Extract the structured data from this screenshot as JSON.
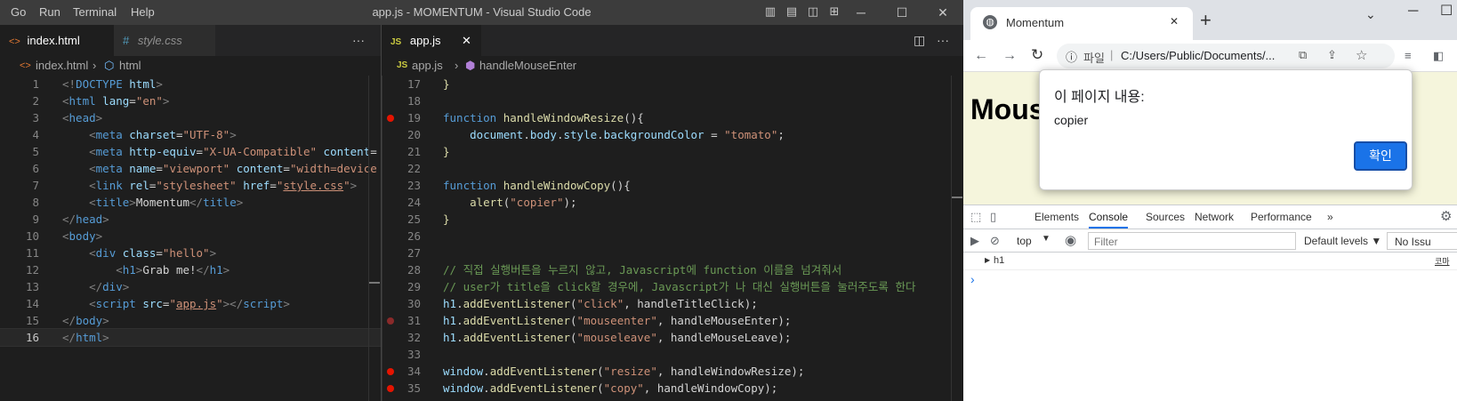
{
  "vscode": {
    "menu": [
      "Go",
      "Run",
      "Terminal",
      "Help"
    ],
    "window_title": "app.js - MOMENTUM - Visual Studio Code",
    "left_pane": {
      "tabs": [
        {
          "label": "index.html",
          "icon": "<>",
          "active": true
        },
        {
          "label": "style.css",
          "icon": "#",
          "active": false
        }
      ],
      "more_label": "···",
      "breadcrumb": {
        "file": "index.html",
        "symbol": "html"
      },
      "lines": [
        {
          "n": "1",
          "tokens": [
            [
              "<!",
              "p"
            ],
            [
              "DOCTYPE",
              "tag"
            ],
            [
              " html",
              "attr"
            ],
            [
              ">",
              "p"
            ]
          ]
        },
        {
          "n": "2",
          "tokens": [
            [
              "<",
              "p"
            ],
            [
              "html",
              "tag"
            ],
            [
              " lang",
              "attr"
            ],
            [
              "=",
              "text"
            ],
            [
              "\"en\"",
              "str"
            ],
            [
              ">",
              "p"
            ]
          ]
        },
        {
          "n": "3",
          "tokens": [
            [
              "<",
              "p"
            ],
            [
              "head",
              "tag"
            ],
            [
              ">",
              "p"
            ]
          ]
        },
        {
          "n": "4",
          "tokens": [
            [
              "    <",
              "p"
            ],
            [
              "meta",
              "tag"
            ],
            [
              " charset",
              "attr"
            ],
            [
              "=",
              "text"
            ],
            [
              "\"UTF-8\"",
              "str"
            ],
            [
              ">",
              "p"
            ]
          ]
        },
        {
          "n": "5",
          "tokens": [
            [
              "    <",
              "p"
            ],
            [
              "meta",
              "tag"
            ],
            [
              " http-equiv",
              "attr"
            ],
            [
              "=",
              "text"
            ],
            [
              "\"X-UA-Compatible\"",
              "str"
            ],
            [
              " content",
              "attr"
            ],
            [
              "=",
              "text"
            ]
          ]
        },
        {
          "n": "6",
          "tokens": [
            [
              "    <",
              "p"
            ],
            [
              "meta",
              "tag"
            ],
            [
              " name",
              "attr"
            ],
            [
              "=",
              "text"
            ],
            [
              "\"viewport\"",
              "str"
            ],
            [
              " content",
              "attr"
            ],
            [
              "=",
              "text"
            ],
            [
              "\"width=device",
              "str"
            ]
          ]
        },
        {
          "n": "7",
          "tokens": [
            [
              "    <",
              "p"
            ],
            [
              "link",
              "tag"
            ],
            [
              " rel",
              "attr"
            ],
            [
              "=",
              "text"
            ],
            [
              "\"stylesheet\"",
              "str"
            ],
            [
              " href",
              "attr"
            ],
            [
              "=",
              "text"
            ],
            [
              "\"",
              "str"
            ],
            [
              "style.css",
              "link"
            ],
            [
              "\"",
              "str"
            ],
            [
              ">",
              "p"
            ]
          ]
        },
        {
          "n": "8",
          "tokens": [
            [
              "    <",
              "p"
            ],
            [
              "title",
              "tag"
            ],
            [
              ">",
              "p"
            ],
            [
              "Momentum",
              "text"
            ],
            [
              "</",
              "p"
            ],
            [
              "title",
              "tag"
            ],
            [
              ">",
              "p"
            ]
          ]
        },
        {
          "n": "9",
          "tokens": [
            [
              "</",
              "p"
            ],
            [
              "head",
              "tag"
            ],
            [
              ">",
              "p"
            ]
          ]
        },
        {
          "n": "10",
          "tokens": [
            [
              "<",
              "p"
            ],
            [
              "body",
              "tag"
            ],
            [
              ">",
              "p"
            ]
          ]
        },
        {
          "n": "11",
          "tokens": [
            [
              "    <",
              "p"
            ],
            [
              "div",
              "tag"
            ],
            [
              " class",
              "attr"
            ],
            [
              "=",
              "text"
            ],
            [
              "\"hello\"",
              "str"
            ],
            [
              ">",
              "p"
            ]
          ]
        },
        {
          "n": "12",
          "tokens": [
            [
              "        <",
              "p"
            ],
            [
              "h1",
              "tag"
            ],
            [
              ">",
              "p"
            ],
            [
              "Grab me!",
              "text"
            ],
            [
              "</",
              "p"
            ],
            [
              "h1",
              "tag"
            ],
            [
              ">",
              "p"
            ]
          ]
        },
        {
          "n": "13",
          "tokens": [
            [
              "    </",
              "p"
            ],
            [
              "div",
              "tag"
            ],
            [
              ">",
              "p"
            ]
          ]
        },
        {
          "n": "14",
          "tokens": [
            [
              "    <",
              "p"
            ],
            [
              "script",
              "tag"
            ],
            [
              " src",
              "attr"
            ],
            [
              "=",
              "text"
            ],
            [
              "\"",
              "str"
            ],
            [
              "app.js",
              "link"
            ],
            [
              "\"",
              "str"
            ],
            [
              "></",
              "p"
            ],
            [
              "script",
              "tag"
            ],
            [
              ">",
              "p"
            ]
          ]
        },
        {
          "n": "15",
          "tokens": [
            [
              "</",
              "p"
            ],
            [
              "body",
              "tag"
            ],
            [
              ">",
              "p"
            ]
          ]
        },
        {
          "n": "16",
          "tokens": [
            [
              "</",
              "p"
            ],
            [
              "html",
              "tag"
            ],
            [
              ">",
              "p"
            ]
          ]
        }
      ]
    },
    "right_pane": {
      "tab": {
        "icon": "JS",
        "label": "app.js",
        "close": "✕"
      },
      "breadcrumb": {
        "file": "app.js",
        "symbol": "handleMouseEnter"
      },
      "lines": [
        {
          "n": "17",
          "bp": "",
          "tokens": [
            [
              "}",
              "fn"
            ]
          ]
        },
        {
          "n": "18",
          "bp": "",
          "tokens": []
        },
        {
          "n": "19",
          "bp": "on",
          "tokens": [
            [
              "function",
              "kw"
            ],
            [
              " ",
              "text"
            ],
            [
              "handleWindowResize",
              "fn"
            ],
            [
              "(){",
              "text"
            ]
          ]
        },
        {
          "n": "20",
          "bp": "",
          "tokens": [
            [
              "    ",
              "text"
            ],
            [
              "document",
              "var"
            ],
            [
              ".",
              "text"
            ],
            [
              "body",
              "var"
            ],
            [
              ".",
              "text"
            ],
            [
              "style",
              "var"
            ],
            [
              ".",
              "text"
            ],
            [
              "backgroundColor",
              "var"
            ],
            [
              " = ",
              "text"
            ],
            [
              "\"tomato\"",
              "str"
            ],
            [
              ";",
              "text"
            ]
          ]
        },
        {
          "n": "21",
          "bp": "",
          "tokens": [
            [
              "}",
              "fn"
            ]
          ]
        },
        {
          "n": "22",
          "bp": "",
          "tokens": []
        },
        {
          "n": "23",
          "bp": "",
          "tokens": [
            [
              "function",
              "kw"
            ],
            [
              " ",
              "text"
            ],
            [
              "handleWindowCopy",
              "fn"
            ],
            [
              "(){",
              "text"
            ]
          ]
        },
        {
          "n": "24",
          "bp": "",
          "tokens": [
            [
              "    ",
              "text"
            ],
            [
              "alert",
              "fn"
            ],
            [
              "(",
              "text"
            ],
            [
              "\"copier\"",
              "str"
            ],
            [
              ");",
              "text"
            ]
          ]
        },
        {
          "n": "25",
          "bp": "",
          "tokens": [
            [
              "}",
              "fn"
            ]
          ]
        },
        {
          "n": "26",
          "bp": "",
          "tokens": []
        },
        {
          "n": "27",
          "bp": "",
          "tokens": []
        },
        {
          "n": "28",
          "bp": "",
          "tokens": [
            [
              "// 직접 실행버튼을 누르지 않고, Javascript에 function 이름을 넘겨줘서",
              "cm"
            ]
          ]
        },
        {
          "n": "29",
          "bp": "",
          "tokens": [
            [
              "// user가 title을 click할 경우에, Javascript가 나 대신 실행버튼을 눌러주도록 한다",
              "cm"
            ]
          ]
        },
        {
          "n": "30",
          "bp": "",
          "tokens": [
            [
              "h1",
              "var"
            ],
            [
              ".",
              "text"
            ],
            [
              "addEventListener",
              "fn"
            ],
            [
              "(",
              "text"
            ],
            [
              "\"click\"",
              "str"
            ],
            [
              ", handleTitleClick);",
              "text"
            ]
          ]
        },
        {
          "n": "31",
          "bp": "dim",
          "tokens": [
            [
              "h1",
              "var"
            ],
            [
              ".",
              "text"
            ],
            [
              "addEventListener",
              "fn"
            ],
            [
              "(",
              "text"
            ],
            [
              "\"mouseenter\"",
              "str"
            ],
            [
              ", handleMouseEnter);",
              "text"
            ]
          ]
        },
        {
          "n": "32",
          "bp": "",
          "tokens": [
            [
              "h1",
              "var"
            ],
            [
              ".",
              "text"
            ],
            [
              "addEventListener",
              "fn"
            ],
            [
              "(",
              "text"
            ],
            [
              "\"mouseleave\"",
              "str"
            ],
            [
              ", handleMouseLeave);",
              "text"
            ]
          ]
        },
        {
          "n": "33",
          "bp": "",
          "tokens": []
        },
        {
          "n": "34",
          "bp": "on",
          "tokens": [
            [
              "window",
              "var"
            ],
            [
              ".",
              "text"
            ],
            [
              "addEventListener",
              "fn"
            ],
            [
              "(",
              "text"
            ],
            [
              "\"resize\"",
              "str"
            ],
            [
              ", handleWindowResize);",
              "text"
            ]
          ]
        },
        {
          "n": "35",
          "bp": "on",
          "tokens": [
            [
              "window",
              "var"
            ],
            [
              ".",
              "text"
            ],
            [
              "addEventListener",
              "fn"
            ],
            [
              "(",
              "text"
            ],
            [
              "\"copy\"",
              "str"
            ],
            [
              ", handleWindowCopy);",
              "text"
            ]
          ]
        }
      ]
    }
  },
  "chrome": {
    "tab_title": "Momentum",
    "tab_close": "✕",
    "new_tab": "+",
    "omnibox": {
      "scheme_label": "파일",
      "url": "C:/Users/Public/Documents/..."
    },
    "page_heading": "Mous",
    "alert": {
      "title": "이 페이지 내용:",
      "message": "copier",
      "ok_label": "확인"
    },
    "devtools": {
      "tabs": [
        "Elements",
        "Console",
        "Sources",
        "Network",
        "Performance"
      ],
      "active_tab": "Console",
      "more": "»",
      "context": "top",
      "filter_placeholder": "Filter",
      "levels": "Default levels ▼",
      "issues": "No Issu",
      "log_entry": "h1",
      "source_link": "코마",
      "prompt": "›"
    }
  },
  "colors": {
    "breakpoint": "#e51400",
    "dialog_ok": "#1a73e8",
    "page_bg": "#f5f5dc"
  }
}
